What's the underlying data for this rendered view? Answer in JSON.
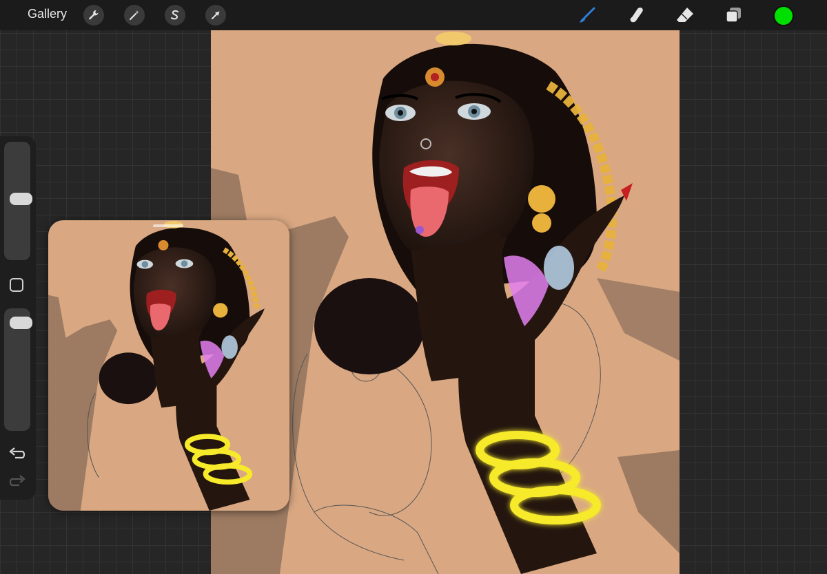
{
  "toolbar": {
    "gallery_label": "Gallery",
    "left_tools": [
      {
        "name": "actions",
        "icon": "wrench-icon"
      },
      {
        "name": "adjustments",
        "icon": "magic-wand-icon"
      },
      {
        "name": "selection",
        "icon": "selection-s-icon"
      },
      {
        "name": "transform",
        "icon": "arrow-cursor-icon"
      }
    ],
    "right_tools": [
      {
        "name": "brush",
        "icon": "brush-icon",
        "active": true
      },
      {
        "name": "smudge",
        "icon": "smudge-finger-icon"
      },
      {
        "name": "eraser",
        "icon": "eraser-icon"
      },
      {
        "name": "layers",
        "icon": "layers-icon"
      }
    ],
    "current_color": "#00e000",
    "active_tool_color": "#2f7fd8"
  },
  "sidebar": {
    "brush_size_fraction": 0.52,
    "opacity_fraction": 0.95
  },
  "colors": {
    "canvas_paper": "#d9a882",
    "skin": "#2a1a14",
    "gold": "#e7b13c",
    "bangle_glow": "#f6ea2a",
    "tongue": "#e9696f",
    "lips": "#9e1f1f",
    "sparkle": "#e27ff0"
  }
}
